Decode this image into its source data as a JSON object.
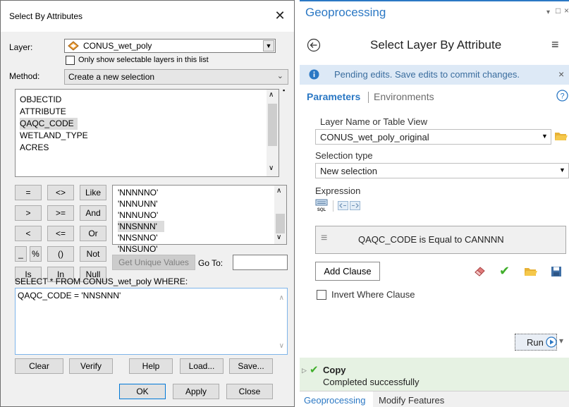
{
  "dialog": {
    "title": "Select By Attributes",
    "close_glyph": "✕",
    "layer_label": "Layer:",
    "layer_value": "CONUS_wet_poly",
    "only_selectable_label": "Only show selectable layers in this list",
    "method_label": "Method:",
    "method_value": "Create a new selection",
    "fields": [
      "OBJECTID",
      "ATTRIBUTE",
      "QAQC_CODE",
      "WETLAND_TYPE",
      "ACRES"
    ],
    "operators": {
      "eq": "=",
      "ne": "<>",
      "like": "Like",
      "gt": ">",
      "ge": ">=",
      "and": "And",
      "lt": "<",
      "le": "<=",
      "or": "Or",
      "underscore": "_",
      "percent": "%",
      "parens": "()",
      "not": "Not",
      "is": "Is",
      "in": "In",
      "null": "Null"
    },
    "values": [
      "'NNNNNO'",
      "'NNNUNN'",
      "'NNNUNO'",
      "'NNSNNN'",
      "'NNSNNO'",
      "'NNSUNO'"
    ],
    "get_unique_label": "Get Unique Values",
    "goto_label": "Go To:",
    "sql_prefix": "SELECT * FROM CONUS_wet_poly WHERE:",
    "expression": "QAQC_CODE = 'NNSNNN'",
    "buttons": {
      "clear": "Clear",
      "verify": "Verify",
      "help": "Help",
      "load": "Load...",
      "save": "Save...",
      "ok": "OK",
      "apply": "Apply",
      "close": "Close"
    }
  },
  "gp": {
    "title": "Geoprocessing",
    "tool_title": "Select Layer By Attribute",
    "notice": "Pending edits. Save edits to commit changes.",
    "tabs": {
      "parameters": "Parameters",
      "environments": "Environments"
    },
    "layer_label": "Layer Name or Table View",
    "layer_value": "CONUS_wet_poly_original",
    "selection_label": "Selection type",
    "selection_value": "New selection",
    "expression_label": "Expression",
    "clause": "QAQC_CODE is Equal to CANNNN",
    "add_clause": "Add Clause",
    "invert_label": "Invert Where Clause",
    "run": "Run",
    "status_title": "Copy",
    "status_text": "Completed successfully",
    "bottom_tabs": [
      "Geoprocessing",
      "Modify Features"
    ],
    "colors": {
      "accent": "#2b78c4",
      "success": "#3fae2a",
      "notice_bg": "#dde9f6",
      "status_bg": "#e6f2e3"
    }
  }
}
